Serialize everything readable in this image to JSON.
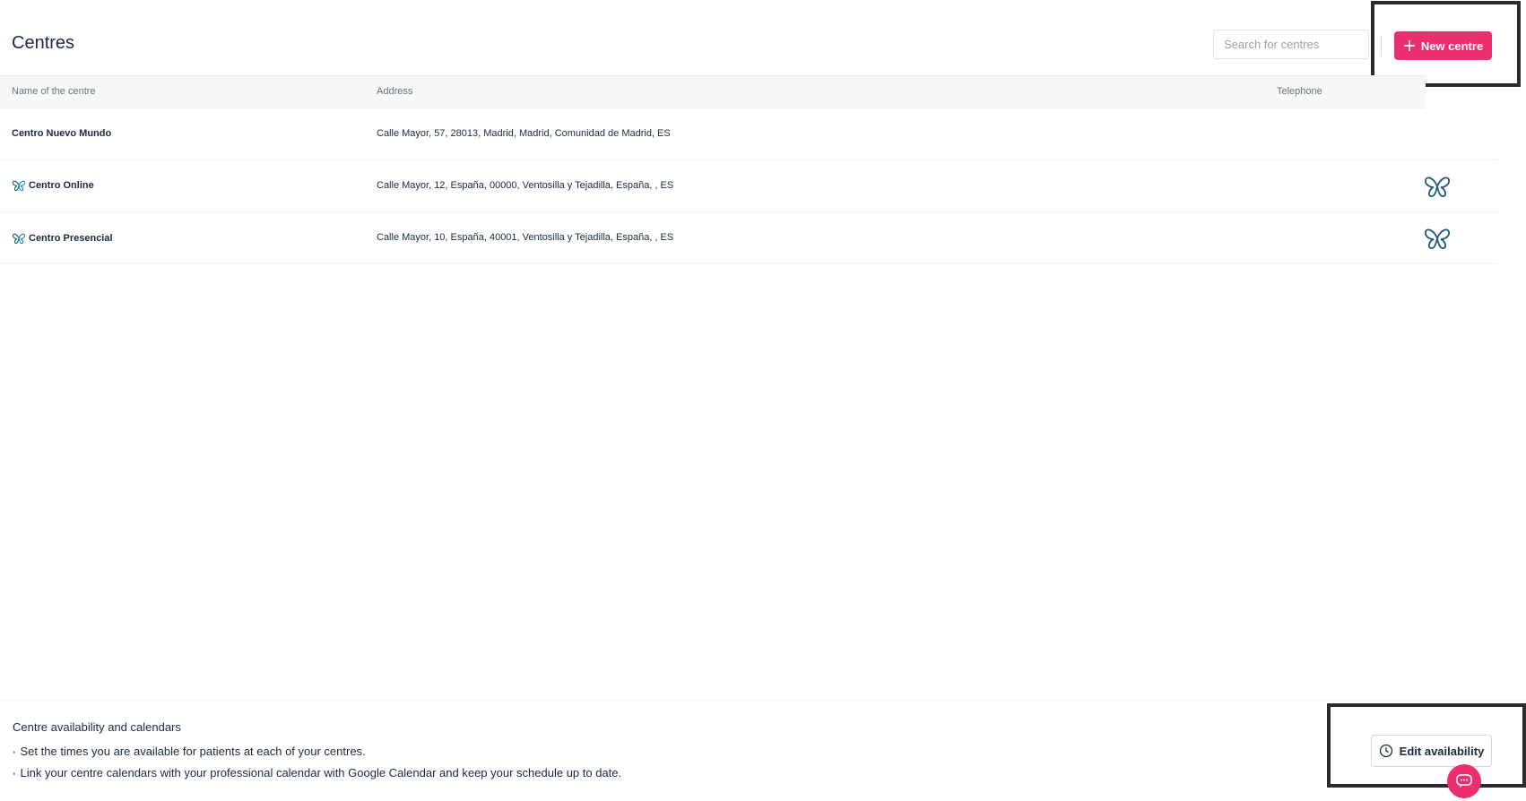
{
  "header": {
    "title": "Centres",
    "search_placeholder": "Search for centres",
    "new_button_label": "New centre"
  },
  "table": {
    "columns": [
      "Name of the centre",
      "Address",
      "Telephone"
    ],
    "rows": [
      {
        "name": "Centro Nuevo Mundo",
        "address": "Calle Mayor, 57, 28013, Madrid, Madrid, Comunidad de Madrid, ES",
        "telephone": "",
        "has_logo": false
      },
      {
        "name": "Centro Online",
        "address": "Calle Mayor, 12, España, 00000, Ventosilla y Tejadilla, España, , ES",
        "telephone": "",
        "has_logo": true
      },
      {
        "name": "Centro Presencial",
        "address": "Calle Mayor, 10, España, 40001, Ventosilla y Tejadilla, España, , ES",
        "telephone": "",
        "has_logo": true
      }
    ]
  },
  "availability": {
    "title": "Centre availability and calendars",
    "bullets": [
      "Set the times you are available for patients at each of your centres.",
      "Link your centre calendars with your professional calendar with Google Calendar and keep your schedule up to date."
    ],
    "edit_button_label": "Edit availability"
  },
  "colors": {
    "accent": "#ee2f6e",
    "logo": "#1f5a7a",
    "text": "#1b2a40"
  },
  "icons": {
    "new_button": "plus-icon",
    "row_logo": "butterfly-logo-icon",
    "edit_button": "clock-icon",
    "chat": "chat-icon"
  }
}
